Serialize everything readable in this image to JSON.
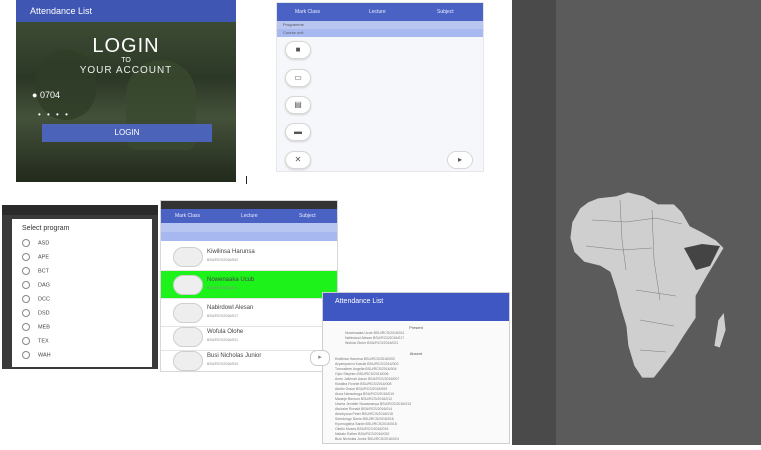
{
  "login_screen": {
    "app_title": "Attendance List",
    "headline": "LOGIN",
    "to": "TO",
    "subline": "YOUR ACCOUNT",
    "username_value": "0704",
    "password_mask": "• • • •",
    "login_button": "LOGIN"
  },
  "icon_screen": {
    "tabs": [
      "Mark Class",
      "Lecture",
      "Subject"
    ],
    "rows": [
      "Programme",
      "Course unit"
    ],
    "icons": [
      "camera-icon",
      "document-icon",
      "keyboard-icon",
      "printer-icon",
      "cancel-icon"
    ],
    "fab": "▸"
  },
  "program_dialog": {
    "title": "Select program",
    "options": [
      "ASD",
      "APE",
      "BCT",
      "DAG",
      "DCC",
      "DSD",
      "MEB",
      "TEX",
      "WAH"
    ]
  },
  "student_list": {
    "tabs": [
      "Mark Class",
      "Lecture",
      "Subject"
    ],
    "students": [
      {
        "name": "Kiwilinsa Harunsa",
        "id": "BSU/RCS/2016/002"
      },
      {
        "name": "Nowenaaka Ucub",
        "id": "BSU/RCS/2016/011"
      },
      {
        "name": "Nabirdowl Alesan",
        "id": "BSU/RCS/2016/017"
      },
      {
        "name": "Wofula Olohe",
        "id": "BSU/RCS/2016/021"
      },
      {
        "name": "Busi Nicholas Junior",
        "id": "BSU/RCS/2016/024"
      }
    ]
  },
  "attendance_screen": {
    "title": "Attendance List",
    "present_header": "Present",
    "absent_header": "Absent",
    "present": [
      "Nowenaaka Ucub    BSU/RCS/2016/011",
      "Nabirdowl Alesan    BSU/RCS/2016/017",
      "Wofula Olohe    BSU/RCS/2016/021"
    ],
    "absent": [
      "Kiwilinsa Harunsa    BSU/RCS/2016/002",
      "Aryampanvu Kasule    BSU/RCS/2016/003",
      "Tumusiime Angella    BSU/RCS/2016/004",
      "Opio Stephen    BSU/RCS/2016/006",
      "Acen Jollenah Aaron    BSU/RCS/2016/007",
      "Kiwalira Ronnie    BSU/RCS/2016/008",
      "Akello Grace    BSU/RCS/2016/009",
      "Anna Nansubuga    BSU/RCS/2016/010",
      "Mwanje Benson    BSU/RCS/2016/012",
      "Uwera Jennifer Nuwamanya    BSU/RCS/2016/013",
      "Atuhaire Ronald    BSU/RCS/2016/014",
      "Ainebyona Peter    BSU/RCS/2016/015",
      "Ssentongo Denis    BSU/RCS/2016/016",
      "Kyomugisha Sarah    BSU/RCS/2016/018",
      "Okello Moses    BSU/RCS/2016/019",
      "Nakato Esther    BSU/RCS/2016/020",
      "Busi Nicholas Junior    BSU/RCS/2016/024",
      "Namuli Joan    BSU/RCS/2016/025"
    ]
  },
  "colors": {
    "primary": "#3f56b3",
    "highlight": "#1ef21b",
    "panel": "#5b5b5b"
  }
}
